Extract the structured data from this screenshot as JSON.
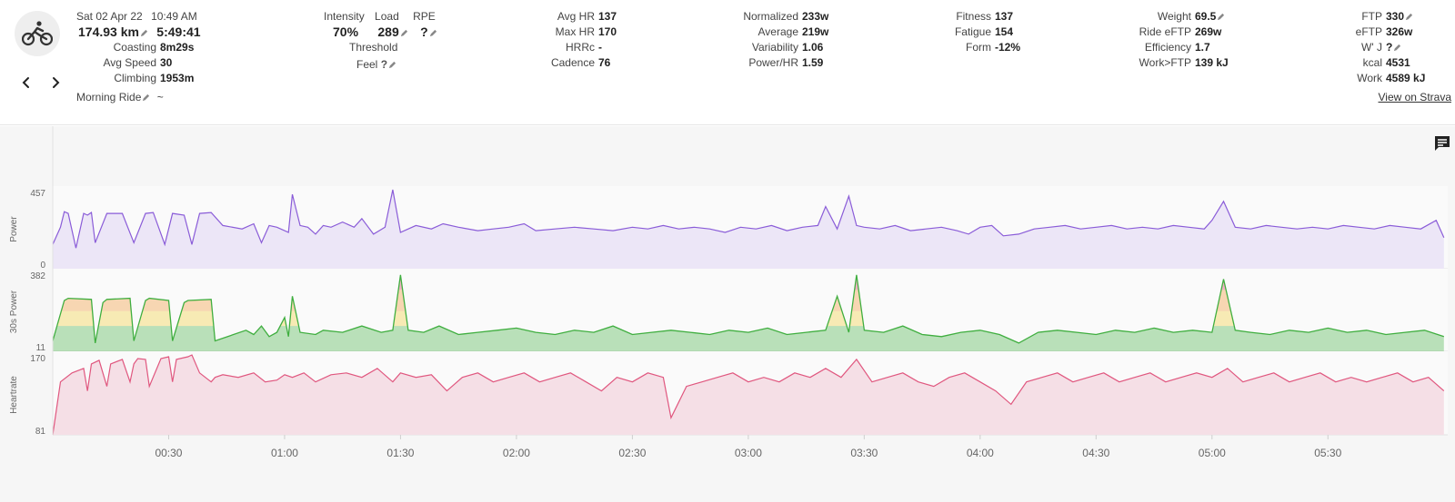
{
  "activity": {
    "icon": "bike-icon",
    "date": "Sat 02 Apr 22",
    "time": "10:49 AM",
    "distance": "174.93 km",
    "duration": "5:49:41",
    "name": "Morning Ride",
    "name_suffix": "~"
  },
  "stats_left": [
    {
      "label": "Coasting",
      "value": "8m29s"
    },
    {
      "label": "Avg Speed",
      "value": "30"
    },
    {
      "label": "Climbing",
      "value": "1953m"
    }
  ],
  "load": {
    "intensity_label": "Intensity",
    "load_label": "Load",
    "rpe_label": "RPE",
    "intensity": "70%",
    "load": "289",
    "rpe": "?",
    "threshold_label": "Threshold",
    "feel_label": "Feel",
    "feel": "?"
  },
  "hr_stats": [
    {
      "label": "Avg HR",
      "value": "137"
    },
    {
      "label": "Max HR",
      "value": "170"
    },
    {
      "label": "HRRc",
      "value": "-"
    },
    {
      "label": "Cadence",
      "value": "76"
    }
  ],
  "power_stats": [
    {
      "label": "Normalized",
      "value": "233w"
    },
    {
      "label": "Average",
      "value": "219w"
    },
    {
      "label": "Variability",
      "value": "1.06"
    },
    {
      "label": "Power/HR",
      "value": "1.59"
    }
  ],
  "fitness_stats": [
    {
      "label": "Fitness",
      "value": "137"
    },
    {
      "label": "Fatigue",
      "value": "154"
    },
    {
      "label": "Form",
      "value": "-12%"
    }
  ],
  "weight_stats": [
    {
      "label": "Weight",
      "value": "69.5",
      "editable": true
    },
    {
      "label": "Ride eFTP",
      "value": "269w"
    },
    {
      "label": "Efficiency",
      "value": "1.7"
    },
    {
      "label": "Work>FTP",
      "value": "139 kJ"
    }
  ],
  "ftp_stats": [
    {
      "label": "FTP",
      "value": "330",
      "editable": true
    },
    {
      "label": "eFTP",
      "value": "326w"
    },
    {
      "label": "W' J",
      "value": "?",
      "editable": true
    },
    {
      "label": "kcal",
      "value": "4531"
    },
    {
      "label": "Work",
      "value": "4589 kJ"
    }
  ],
  "strava_link": "View on Strava",
  "colors": {
    "power": "#8a5cd8",
    "power_fill": "#ece6f7",
    "hr": "#e0577f",
    "hr_fill": "#f5dfe6",
    "zone_green": "#3fae3f",
    "zone_yellow": "#f2cc30",
    "zone_orange": "#f0932b",
    "zone_red": "#e0245e",
    "zone_teal": "#2aa88a"
  },
  "chart_data": {
    "type": "line",
    "x_unit": "elapsed time (h:mm)",
    "x_ticks": [
      "00:30",
      "01:00",
      "01:30",
      "02:00",
      "02:30",
      "03:00",
      "03:30",
      "04:00",
      "04:30",
      "05:00",
      "05:30"
    ],
    "x_tick_minutes": [
      30,
      60,
      90,
      120,
      150,
      180,
      210,
      240,
      270,
      300,
      330
    ],
    "x_range_minutes": [
      0,
      361
    ],
    "series": [
      {
        "name": "Power",
        "ylim": [
          0,
          457
        ],
        "y_ticks": [
          "457",
          "0"
        ],
        "x_minutes": [
          0,
          2,
          3,
          4,
          6,
          8,
          9,
          10,
          11,
          14,
          18,
          21,
          24,
          26,
          29,
          31,
          34,
          36,
          38,
          41,
          44,
          49,
          52,
          54,
          56,
          58,
          61,
          62,
          64,
          66,
          68,
          70,
          72,
          75,
          78,
          80,
          83,
          86,
          88,
          90,
          94,
          98,
          101,
          105,
          110,
          114,
          118,
          122,
          125,
          130,
          135,
          140,
          145,
          150,
          154,
          158,
          162,
          166,
          170,
          174,
          178,
          182,
          186,
          190,
          194,
          198,
          200,
          203,
          206,
          208,
          210,
          214,
          218,
          222,
          226,
          230,
          234,
          237,
          240,
          243,
          246,
          250,
          254,
          258,
          262,
          266,
          270,
          274,
          278,
          282,
          286,
          290,
          294,
          298,
          300,
          303,
          306,
          310,
          314,
          318,
          322,
          326,
          330,
          334,
          338,
          342,
          346,
          350,
          354,
          358,
          360
        ],
        "values": [
          140,
          240,
          330,
          320,
          120,
          320,
          310,
          325,
          150,
          320,
          320,
          150,
          320,
          325,
          140,
          320,
          310,
          140,
          320,
          325,
          250,
          230,
          260,
          150,
          250,
          240,
          210,
          430,
          250,
          240,
          200,
          250,
          240,
          270,
          240,
          290,
          200,
          240,
          470,
          210,
          250,
          230,
          260,
          240,
          220,
          230,
          240,
          260,
          220,
          230,
          240,
          230,
          220,
          240,
          230,
          250,
          230,
          240,
          230,
          210,
          240,
          230,
          250,
          220,
          240,
          250,
          360,
          230,
          420,
          250,
          240,
          230,
          250,
          220,
          230,
          240,
          220,
          200,
          240,
          250,
          190,
          200,
          230,
          240,
          250,
          230,
          240,
          250,
          230,
          240,
          230,
          250,
          240,
          230,
          280,
          390,
          240,
          230,
          250,
          240,
          230,
          240,
          230,
          250,
          240,
          230,
          250,
          240,
          230,
          280,
          180
        ]
      },
      {
        "name": "30s Power",
        "ylim": [
          11,
          382
        ],
        "y_ticks": [
          "382",
          "11"
        ],
        "x_minutes": [
          0,
          3,
          4,
          10,
          11,
          13,
          14,
          20,
          21,
          24,
          25,
          30,
          31,
          34,
          35,
          41,
          42,
          50,
          52,
          54,
          56,
          58,
          60,
          61,
          62,
          64,
          68,
          70,
          75,
          80,
          85,
          88,
          90,
          92,
          96,
          100,
          105,
          110,
          115,
          120,
          125,
          130,
          135,
          140,
          145,
          150,
          155,
          160,
          165,
          170,
          175,
          180,
          185,
          190,
          195,
          200,
          203,
          206,
          208,
          210,
          215,
          220,
          225,
          230,
          235,
          240,
          245,
          250,
          255,
          260,
          265,
          270,
          275,
          280,
          285,
          290,
          295,
          300,
          303,
          306,
          310,
          315,
          320,
          325,
          330,
          335,
          340,
          345,
          350,
          355,
          360
        ],
        "values": [
          60,
          250,
          260,
          255,
          50,
          240,
          255,
          260,
          60,
          250,
          260,
          250,
          60,
          240,
          250,
          255,
          60,
          110,
          90,
          130,
          80,
          100,
          170,
          80,
          270,
          100,
          90,
          110,
          100,
          130,
          100,
          110,
          370,
          110,
          100,
          130,
          90,
          100,
          110,
          120,
          100,
          90,
          110,
          100,
          130,
          90,
          100,
          110,
          100,
          90,
          110,
          100,
          120,
          90,
          100,
          110,
          270,
          100,
          370,
          110,
          100,
          130,
          90,
          80,
          100,
          110,
          90,
          50,
          100,
          110,
          100,
          90,
          110,
          100,
          120,
          100,
          110,
          100,
          350,
          110,
          100,
          90,
          110,
          100,
          120,
          100,
          110,
          90,
          100,
          110,
          80
        ]
      },
      {
        "name": "Heartrate",
        "ylim": [
          81,
          170
        ],
        "y_ticks": [
          "170",
          "81"
        ],
        "x_minutes": [
          0,
          2,
          5,
          8,
          9,
          10,
          12,
          14,
          15,
          18,
          20,
          21,
          22,
          24,
          25,
          28,
          30,
          31,
          32,
          35,
          36,
          38,
          41,
          42,
          44,
          48,
          52,
          55,
          58,
          60,
          62,
          65,
          68,
          72,
          76,
          80,
          84,
          88,
          90,
          94,
          98,
          102,
          106,
          110,
          114,
          118,
          122,
          126,
          130,
          134,
          138,
          142,
          146,
          150,
          154,
          158,
          160,
          164,
          168,
          172,
          176,
          180,
          184,
          188,
          192,
          196,
          200,
          204,
          208,
          212,
          216,
          220,
          224,
          228,
          232,
          236,
          240,
          244,
          248,
          252,
          256,
          260,
          264,
          268,
          272,
          276,
          280,
          284,
          288,
          292,
          296,
          300,
          304,
          308,
          312,
          316,
          320,
          324,
          328,
          332,
          336,
          340,
          344,
          348,
          352,
          356,
          360
        ],
        "values": [
          81,
          140,
          150,
          155,
          130,
          160,
          164,
          135,
          160,
          165,
          140,
          160,
          166,
          165,
          135,
          166,
          168,
          140,
          165,
          168,
          170,
          150,
          140,
          145,
          148,
          145,
          150,
          140,
          142,
          148,
          145,
          150,
          140,
          148,
          150,
          145,
          155,
          140,
          150,
          145,
          148,
          130,
          145,
          150,
          140,
          145,
          150,
          140,
          145,
          150,
          140,
          130,
          145,
          140,
          150,
          145,
          100,
          135,
          140,
          145,
          150,
          140,
          145,
          140,
          150,
          145,
          155,
          145,
          165,
          140,
          145,
          150,
          140,
          135,
          145,
          150,
          140,
          130,
          115,
          140,
          145,
          150,
          140,
          145,
          150,
          140,
          145,
          150,
          140,
          145,
          150,
          145,
          155,
          140,
          145,
          150,
          140,
          145,
          150,
          140,
          145,
          140,
          145,
          150,
          140,
          145,
          130
        ]
      }
    ],
    "legend": "none",
    "grid": false
  }
}
